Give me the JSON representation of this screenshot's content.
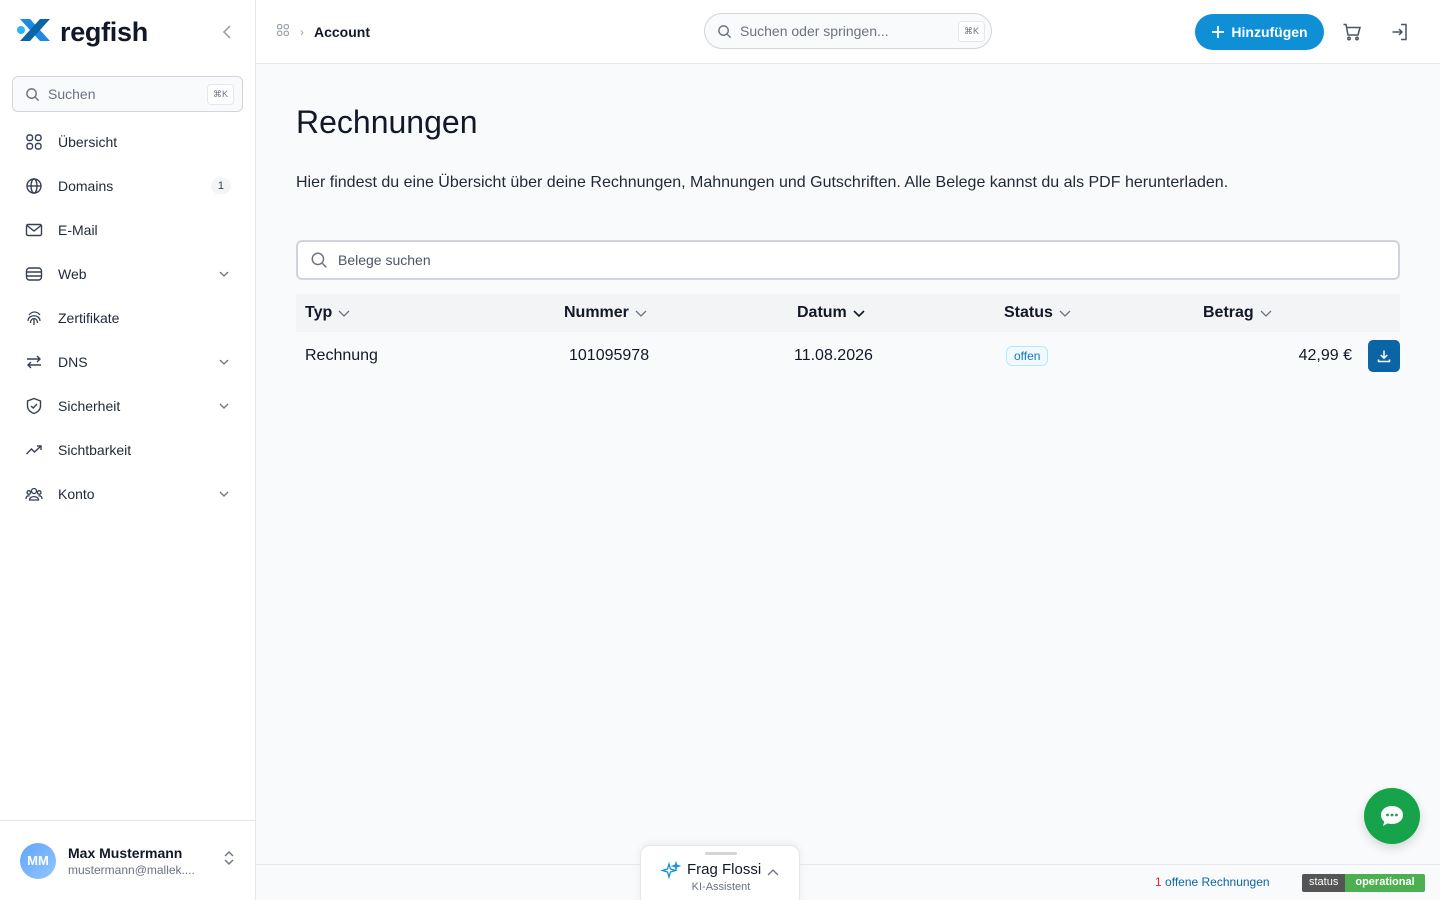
{
  "brand": {
    "name": "regfish"
  },
  "sidebar": {
    "search": {
      "placeholder": "Suchen",
      "shortcut": "⌘K"
    },
    "items": [
      {
        "label": "Übersicht",
        "icon": "grid-icon"
      },
      {
        "label": "Domains",
        "icon": "globe-icon",
        "badge": "1"
      },
      {
        "label": "E-Mail",
        "icon": "mail-icon"
      },
      {
        "label": "Web",
        "icon": "server-icon",
        "expandable": true
      },
      {
        "label": "Zertifikate",
        "icon": "fingerprint-icon"
      },
      {
        "label": "DNS",
        "icon": "arrows-exchange-icon",
        "expandable": true
      },
      {
        "label": "Sicherheit",
        "icon": "shield-check-icon",
        "expandable": true
      },
      {
        "label": "Sichtbarkeit",
        "icon": "trending-up-icon"
      },
      {
        "label": "Konto",
        "icon": "users-icon",
        "expandable": true
      }
    ],
    "user": {
      "initials": "MM",
      "name": "Max Mustermann",
      "email": "mustermann@mallek...."
    }
  },
  "topbar": {
    "breadcrumb": {
      "current": "Account"
    },
    "search": {
      "placeholder": "Suchen oder springen...",
      "shortcut": "⌘K"
    },
    "add_button": "Hinzufügen"
  },
  "main": {
    "title": "Rechnungen",
    "description": "Hier findest du eine Übersicht über deine Rechnungen, Mahnungen und Gutschriften. Alle Belege kannst du als PDF herunterladen.",
    "table_search_placeholder": "Belege suchen",
    "columns": [
      "Typ",
      "Nummer",
      "Datum",
      "Status",
      "Betrag"
    ],
    "rows": [
      {
        "typ": "Rechnung",
        "nummer": "101095978",
        "datum": "11.08.2026",
        "status": "offen",
        "betrag": "42,99 €"
      }
    ]
  },
  "footer": {
    "open_invoices_count": "1",
    "open_invoices_label": "offene Rechnungen",
    "status_label": "status",
    "status_value": "operational"
  },
  "assistant": {
    "title": "Frag Flossi",
    "subtitle": "KI-Assistent"
  },
  "colors": {
    "accent": "#0e8fd6",
    "download": "#0b64a3",
    "chat": "#16a34a",
    "status_ok": "#4caf50"
  }
}
